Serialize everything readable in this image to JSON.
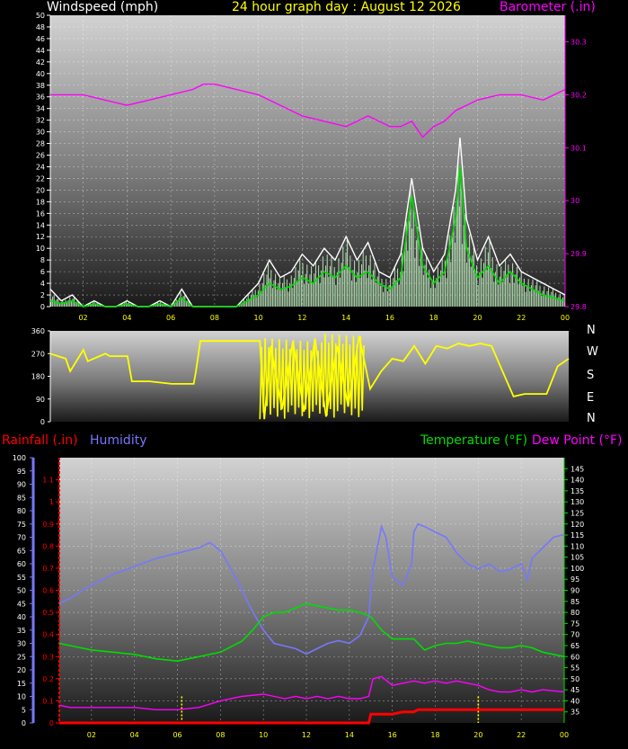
{
  "header": {
    "wind_label": "Windspeed (mph)",
    "title": "24 hour graph day : August 12 2026",
    "baro_label": "Barometer (.in)"
  },
  "lower_header": {
    "rain_label": "Rainfall (.in)",
    "humidity_label": "Humidity",
    "temp_label": "Temperature (°F)",
    "dew_label": "Dew Point (°F)"
  },
  "direction_labels": [
    "N",
    "W",
    "S",
    "E",
    "N"
  ],
  "colors": {
    "wind_label": "#ffffff",
    "title": "#ffff00",
    "barometer": "#ff00ff",
    "gust": "#ffffff",
    "wind_avg": "#00dd00",
    "wind_fill": "#ccffcc",
    "direction": "#ffff00",
    "rainfall": "#ff0000",
    "humidity": "#7777ff",
    "temperature": "#00dd00",
    "dew_point": "#ff00ff",
    "marker": "#ffff00"
  },
  "chart_data": [
    {
      "type": "line",
      "title": "24 hour graph day : August 12 2026",
      "x_ticks": [
        "02",
        "04",
        "06",
        "08",
        "10",
        "12",
        "14",
        "16",
        "18",
        "20",
        "22",
        "00"
      ],
      "x_range_hours": [
        0.5,
        24
      ],
      "y_left_label": "Windspeed (mph)",
      "y_left_range": [
        0,
        50
      ],
      "y_left_ticks": [
        0,
        2,
        4,
        6,
        8,
        10,
        12,
        14,
        16,
        18,
        20,
        22,
        24,
        26,
        28,
        30,
        32,
        34,
        36,
        38,
        40,
        42,
        44,
        46,
        48,
        50
      ],
      "y_right_label": "Barometer (.in)",
      "y_right_range": [
        29.8,
        30.35
      ],
      "y_right_ticks": [
        29.8,
        29.9,
        30,
        30.1,
        30.2,
        30.3
      ],
      "y_right_tick_labels": [
        "29.8",
        "29.9",
        "30",
        "30.1",
        "30.2",
        "30.3"
      ],
      "grid": true,
      "series": [
        {
          "name": "Barometer (.in)",
          "axis": "right",
          "x": [
            0.5,
            1,
            2,
            3,
            4,
            5,
            6,
            7,
            7.5,
            8,
            9,
            10,
            11,
            12,
            13,
            14,
            15,
            15.5,
            16,
            16.5,
            17,
            17.5,
            18,
            18.5,
            19,
            19.5,
            20,
            21,
            22,
            23,
            24
          ],
          "y": [
            30.2,
            30.2,
            30.2,
            30.19,
            30.18,
            30.19,
            30.2,
            30.21,
            30.22,
            30.22,
            30.21,
            30.2,
            30.18,
            30.16,
            30.15,
            30.14,
            30.16,
            30.15,
            30.14,
            30.14,
            30.15,
            30.12,
            30.14,
            30.15,
            30.17,
            30.18,
            30.19,
            30.2,
            30.2,
            30.19,
            30.21
          ]
        },
        {
          "x": [
            0.5,
            1,
            1.5,
            2,
            2.5,
            3,
            3.5,
            4,
            4.5,
            5,
            5.5,
            6,
            6.5,
            7,
            7.5,
            8,
            8.5,
            9,
            9.5,
            10,
            10.5,
            11,
            11.5,
            12,
            12.5,
            13,
            13.5,
            14,
            14.5,
            15,
            15.5,
            16,
            16.5,
            17,
            17.5,
            18,
            18.5,
            19,
            19.2,
            19.5,
            20,
            20.5,
            21,
            21.5,
            22,
            22.5,
            23,
            23.5,
            24
          ],
          "y": [
            3,
            1,
            2,
            0,
            1,
            0,
            0,
            1,
            0,
            0,
            1,
            0,
            3,
            0,
            0,
            0,
            0,
            0,
            2,
            4,
            8,
            5,
            6,
            9,
            7,
            10,
            8,
            12,
            8,
            11,
            6,
            5,
            9,
            22,
            10,
            6,
            9,
            20,
            29,
            15,
            8,
            12,
            7,
            9,
            6,
            5,
            4,
            3,
            2
          ]
        },
        {
          "x": [
            0.5,
            1,
            1.5,
            2,
            2.5,
            3,
            3.5,
            4,
            4.5,
            5,
            5.5,
            6,
            6.5,
            7,
            7.5,
            8,
            8.5,
            9,
            9.5,
            10,
            10.5,
            11,
            11.5,
            12,
            12.5,
            13,
            13.5,
            14,
            14.5,
            15,
            15.5,
            16,
            16.5,
            17,
            17.5,
            18,
            18.5,
            19,
            19.2,
            19.5,
            20,
            20.5,
            21,
            21.5,
            22,
            22.5,
            23,
            23.5,
            24
          ],
          "y": [
            1,
            0.5,
            1,
            0,
            0.5,
            0,
            0,
            0.5,
            0,
            0,
            0.5,
            0,
            1.5,
            0,
            0,
            0,
            0,
            0,
            1,
            2,
            4,
            3,
            3.5,
            5,
            4,
            6,
            5,
            7,
            5,
            6,
            4,
            3,
            5,
            19,
            7,
            4,
            6,
            15,
            24,
            10,
            5,
            7,
            4,
            6,
            4,
            3,
            2,
            1.5,
            1
          ]
        }
      ]
    },
    {
      "type": "line",
      "x_range_hours": [
        0.5,
        24
      ],
      "y_range": [
        0,
        360
      ],
      "y_ticks": [
        0,
        90,
        180,
        270,
        360
      ],
      "direction_labels": [
        "N",
        "W",
        "S",
        "E",
        "N"
      ],
      "grid": false,
      "series": [
        {
          "x": [
            0.5,
            1.2,
            1.4,
            2,
            2.2,
            3,
            3.2,
            4,
            4.2,
            5,
            5.5,
            6,
            6.5,
            7,
            7.1,
            7.3,
            8,
            9,
            10,
            10.2,
            10.5,
            11,
            11.5,
            12,
            12.5,
            13,
            13.5,
            14,
            14.5,
            15,
            15.5,
            16,
            16.5,
            17,
            17.5,
            18,
            18.5,
            19,
            19.5,
            20,
            20.5,
            21,
            21.3,
            21.5,
            22,
            23,
            23.5,
            24
          ],
          "y": [
            270,
            250,
            200,
            285,
            240,
            270,
            260,
            260,
            160,
            160,
            155,
            150,
            150,
            150,
            200,
            320,
            320,
            320,
            320,
            10,
            300,
            50,
            320,
            40,
            330,
            20,
            300,
            60,
            340,
            130,
            200,
            250,
            240,
            300,
            230,
            300,
            290,
            310,
            300,
            310,
            300,
            200,
            140,
            100,
            110,
            110,
            220,
            250
          ]
        }
      ]
    },
    {
      "type": "line",
      "x_ticks": [
        "02",
        "04",
        "06",
        "08",
        "10",
        "12",
        "14",
        "16",
        "18",
        "20",
        "22",
        "00"
      ],
      "x_range_hours": [
        0.5,
        24
      ],
      "grid": true,
      "humidity_axis": {
        "label": "Humidity",
        "range": [
          0,
          100
        ],
        "ticks": [
          0,
          5,
          10,
          15,
          20,
          25,
          30,
          35,
          40,
          45,
          50,
          55,
          60,
          65,
          70,
          75,
          80,
          85,
          90,
          95,
          100
        ]
      },
      "rain_axis": {
        "label": "Rainfall (.in)",
        "range": [
          0,
          1.2
        ],
        "ticks": [
          0,
          0.1,
          0.2,
          0.3,
          0.4,
          0.5,
          0.6,
          0.7,
          0.8,
          0.9,
          1,
          1.1
        ],
        "tick_labels": [
          "0",
          "0.1",
          "0.2",
          "0.3",
          "0.4",
          "0.5",
          "0.6",
          "0.7",
          "0.8",
          "0.9",
          "1",
          "1.1"
        ]
      },
      "temp_axis": {
        "label": "Temperature (°F)",
        "range": [
          30,
          150
        ],
        "ticks": [
          35,
          40,
          45,
          50,
          55,
          60,
          65,
          70,
          75,
          80,
          85,
          90,
          95,
          100,
          105,
          110,
          115,
          120,
          125,
          130,
          135,
          140,
          145
        ]
      },
      "markers_hours": [
        6.2,
        20
      ],
      "series": [
        {
          "name": "Rainfall (.in)",
          "axis": "rain",
          "x": [
            0.5,
            14.9,
            15,
            16,
            16.5,
            17,
            17.2,
            24
          ],
          "y": [
            0,
            0,
            0.04,
            0.04,
            0.05,
            0.05,
            0.06,
            0.06
          ]
        },
        {
          "name": "Humidity",
          "axis": "humidity",
          "x": [
            0.5,
            1,
            2,
            3,
            4,
            5,
            6,
            7,
            7.5,
            8,
            8.5,
            9,
            9.5,
            10,
            10.5,
            11,
            11.5,
            12,
            12.5,
            13,
            13.5,
            14,
            14.5,
            14.9,
            15.1,
            15.5,
            15.7,
            16,
            16.5,
            16.9,
            17,
            17.2,
            17.5,
            18,
            18.5,
            19,
            19.5,
            20,
            20.5,
            21,
            21.5,
            22,
            22.3,
            22.5,
            23,
            23.5,
            24
          ],
          "y": [
            45,
            47,
            52,
            56,
            59,
            62,
            64,
            66,
            68,
            65,
            58,
            50,
            42,
            35,
            30,
            29,
            28,
            26,
            28,
            30,
            31,
            30,
            33,
            40,
            58,
            74,
            70,
            55,
            52,
            60,
            72,
            75,
            74,
            72,
            70,
            64,
            60,
            58,
            60,
            57,
            58,
            60,
            54,
            62,
            66,
            70,
            71
          ]
        },
        {
          "name": "Temperature (°F)",
          "axis": "temp",
          "x": [
            0.5,
            1,
            2,
            3,
            4,
            5,
            6,
            7,
            8,
            9,
            9.5,
            10,
            10.5,
            11,
            11.5,
            12,
            12.5,
            13,
            13.5,
            14,
            14.5,
            15,
            15.5,
            16,
            16.5,
            17,
            17.5,
            18,
            18.5,
            19,
            19.5,
            20,
            20.5,
            21,
            21.5,
            22,
            22.5,
            23,
            24
          ],
          "y": [
            66,
            65,
            63,
            62,
            61,
            59,
            58,
            60,
            62,
            67,
            72,
            78,
            80,
            80,
            82,
            84,
            83,
            82,
            81,
            81,
            80,
            78,
            72,
            68,
            68,
            68,
            63,
            65,
            66,
            66,
            67,
            66,
            65,
            64,
            64,
            65,
            64,
            62,
            60
          ]
        },
        {
          "name": "Dew Point (°F)",
          "axis": "temp",
          "x": [
            0.5,
            1,
            2,
            3,
            4,
            5,
            6,
            7,
            8,
            9,
            10,
            10.5,
            11,
            11.5,
            12,
            12.5,
            13,
            13.5,
            14,
            14.5,
            14.9,
            15.1,
            15.5,
            16,
            16.5,
            17,
            17.5,
            18,
            18.5,
            19,
            19.5,
            20,
            20.5,
            21,
            21.5,
            22,
            22.5,
            23,
            24
          ],
          "y": [
            38,
            37,
            37,
            37,
            37,
            36,
            36,
            37,
            40,
            42,
            43,
            42,
            41,
            42,
            41,
            42,
            41,
            42,
            41,
            41,
            42,
            50,
            51,
            47,
            48,
            49,
            48,
            49,
            48,
            49,
            48,
            47,
            45,
            44,
            44,
            45,
            44,
            45,
            44
          ]
        }
      ]
    }
  ]
}
